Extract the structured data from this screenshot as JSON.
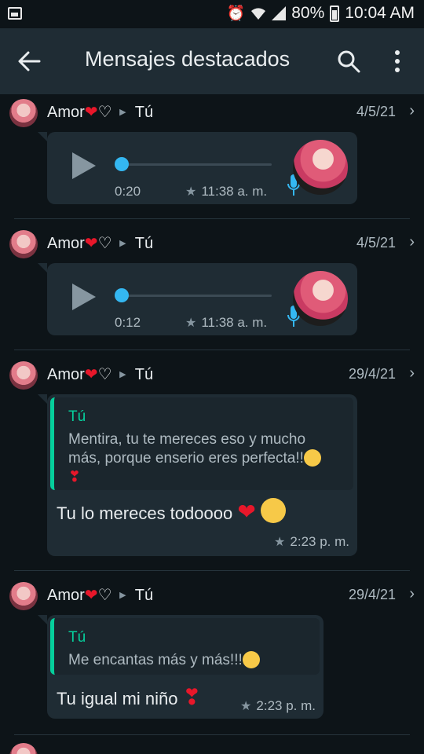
{
  "status": {
    "battery": "80%",
    "time": "10:04 AM"
  },
  "header": {
    "title": "Mensajes destacados"
  },
  "entries": [
    {
      "sender": "Amor",
      "sender_suffix": "♡",
      "recipient": "Tú",
      "date": "4/5/21",
      "type": "voice",
      "duration": "0:20",
      "time": "11:38 a. m."
    },
    {
      "sender": "Amor",
      "sender_suffix": "♡",
      "recipient": "Tú",
      "date": "4/5/21",
      "type": "voice",
      "duration": "0:12",
      "time": "11:38 a. m."
    },
    {
      "sender": "Amor",
      "sender_suffix": "♡",
      "recipient": "Tú",
      "date": "29/4/21",
      "type": "reply",
      "quote_author": "Tú",
      "quote_line1": "Mentira, tu te mereces eso y mucho",
      "quote_line2": "más, porque enserio eres perfecta!!",
      "message": "Tu lo mereces todoooo",
      "time": "2:23 p. m."
    },
    {
      "sender": "Amor",
      "sender_suffix": "♡",
      "recipient": "Tú",
      "date": "29/4/21",
      "type": "reply",
      "quote_author": "Tú",
      "quote_line1": "Me encantas más y más!!!",
      "message": "Tu igual mi niño",
      "time": "2:23 p. m."
    }
  ],
  "colors": {
    "background": "#0d1418",
    "appbar": "#1f2c34",
    "bubble": "#1f2c34",
    "accent_green": "#06cf9c",
    "accent_blue": "#34b7f1"
  }
}
